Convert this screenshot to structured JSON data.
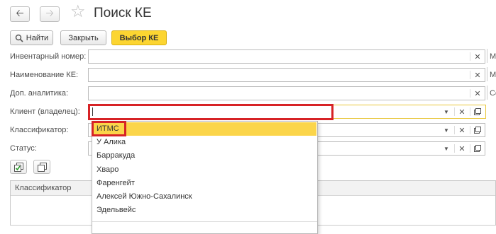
{
  "window": {
    "title": "Поиск КЕ",
    "back_icon": "arrow-left-icon",
    "forward_icon": "arrow-right-icon",
    "favorite_icon": "star-icon"
  },
  "toolbar": {
    "find_label": "Найти",
    "close_label": "Закрыть",
    "select_label": "Выбор КЕ"
  },
  "form": {
    "inventory_label": "Инвентарный номер:",
    "inventory_trail": "М",
    "name_label": "Наименование КЕ:",
    "name_trail": "М",
    "analytics_label": "Доп. аналитика:",
    "analytics_trail": "Со",
    "client_label": "Клиент (владелец):",
    "client_value": "",
    "classifier_label": "Классификатор:",
    "status_label": "Статус:"
  },
  "dropdown": {
    "items": [
      "ИТМС",
      "У Алика",
      "Барракуда",
      "Хварo",
      "Фаренгейт",
      "Алексей Южно-Сахалинск",
      "Эдельвейс"
    ]
  },
  "table": {
    "column_classifier": "Классификатор"
  },
  "colors": {
    "accent_yellow": "#fcd531",
    "highlight_red": "#d72326",
    "focus_border": "#e8c63a"
  }
}
